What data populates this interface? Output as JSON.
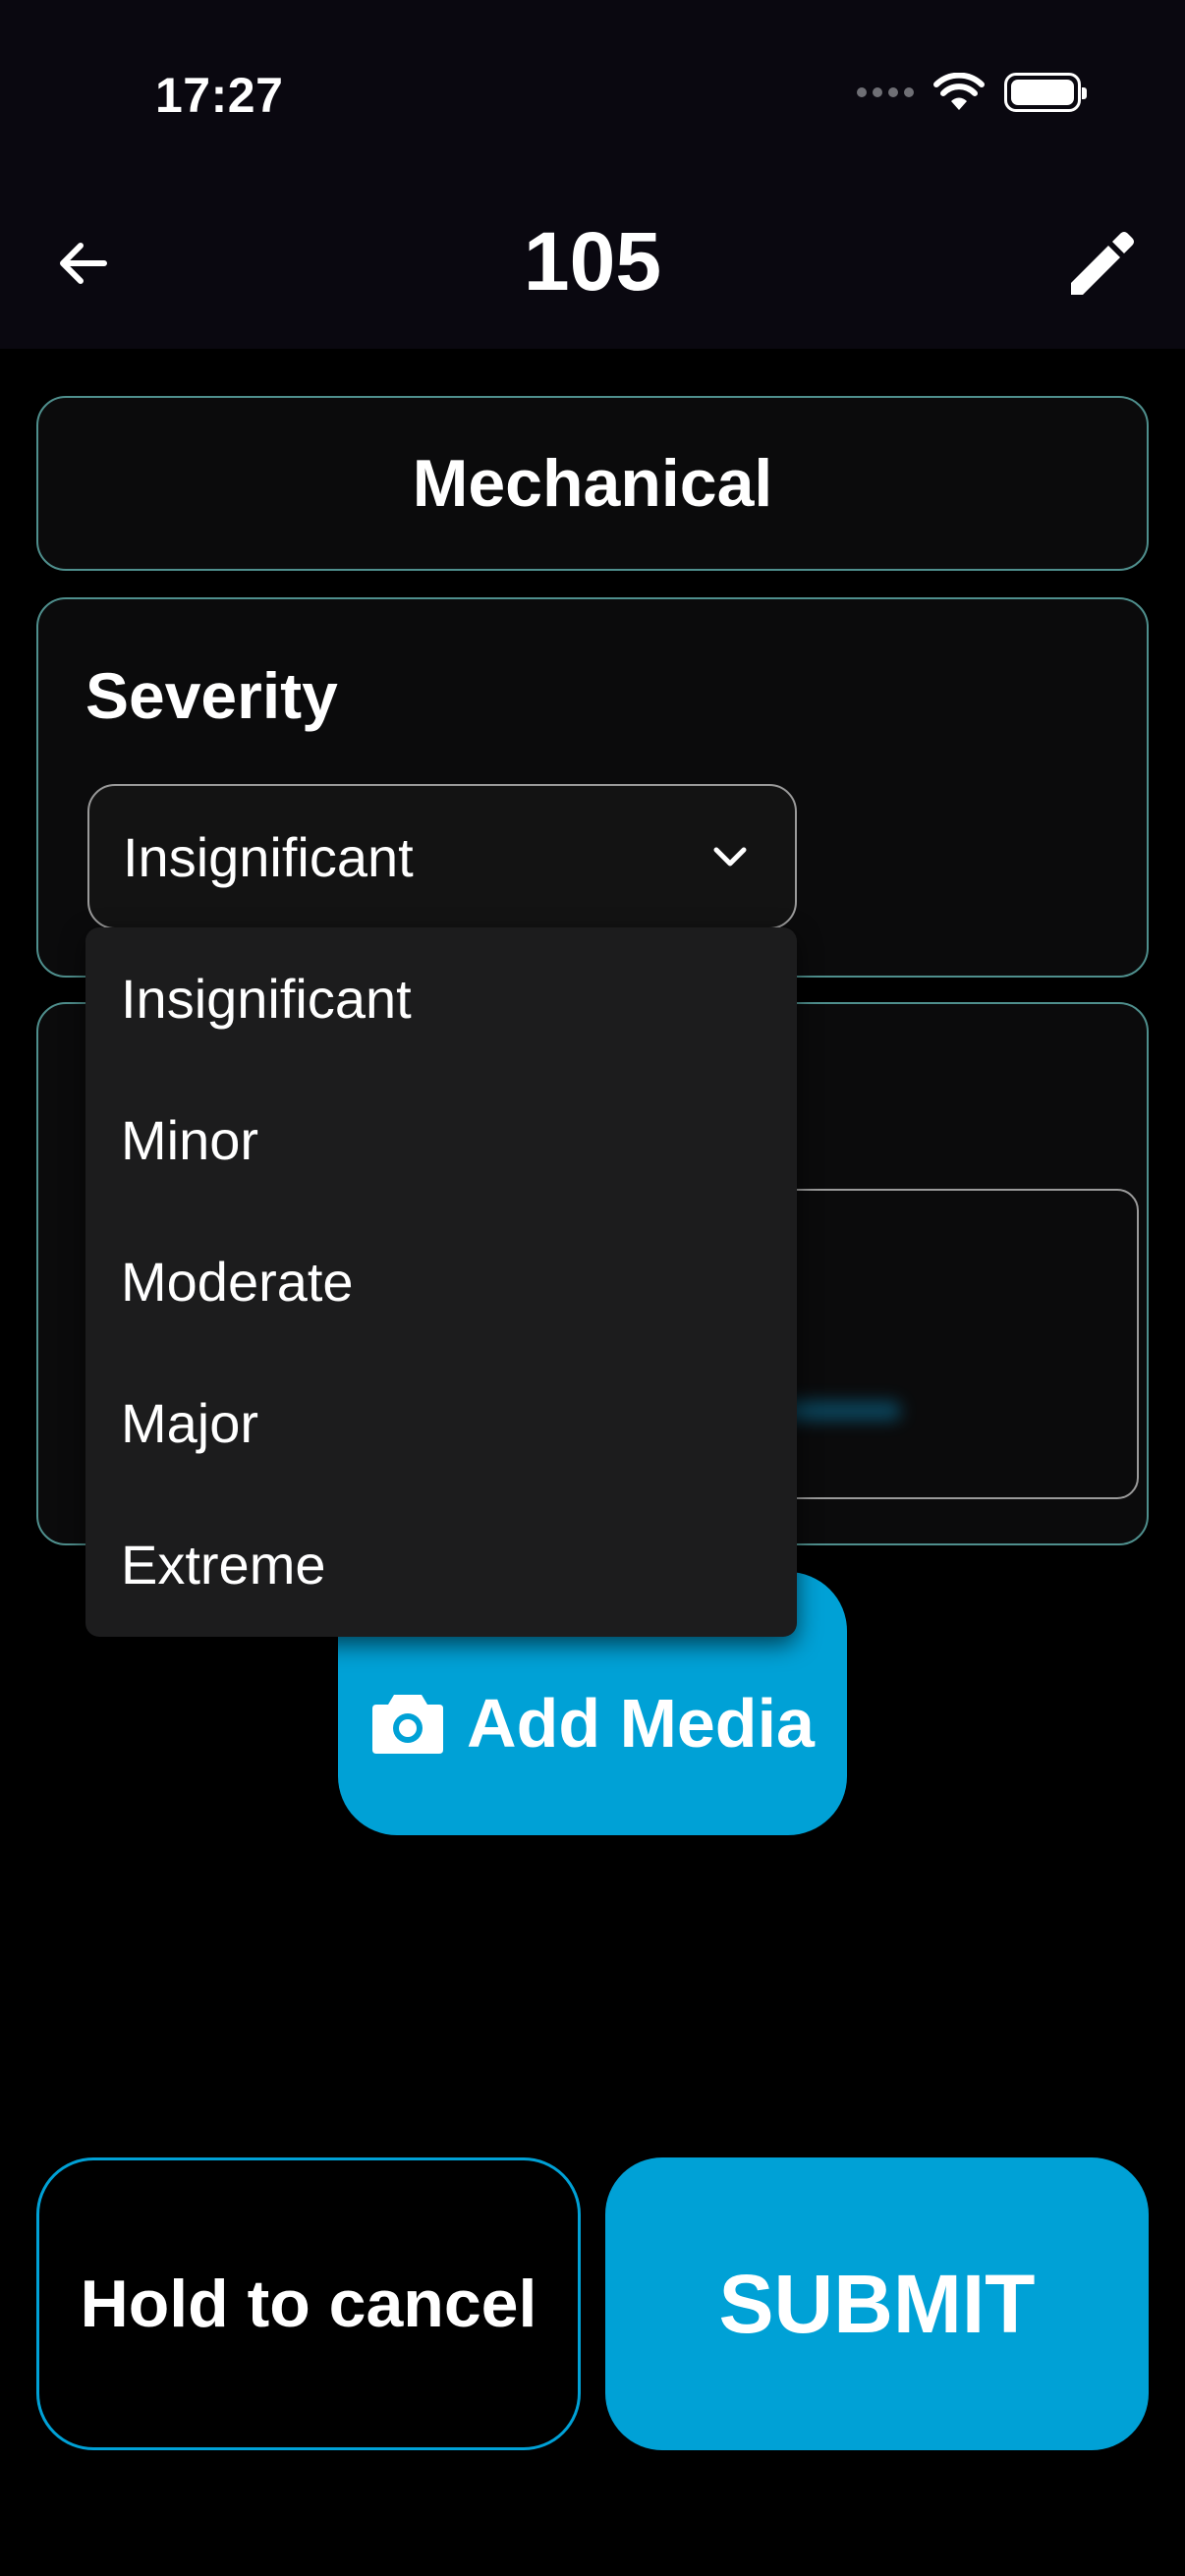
{
  "status_bar": {
    "time": "17:27"
  },
  "header": {
    "title": "105",
    "back_icon": "arrow-left-icon",
    "edit_icon": "pencil-icon"
  },
  "category": {
    "value": "Mechanical"
  },
  "severity": {
    "label": "Severity",
    "selected": "Insignificant",
    "options": [
      "Insignificant",
      "Minor",
      "Moderate",
      "Major",
      "Extreme"
    ]
  },
  "media": {
    "button_label": "Add Media",
    "icon": "camera-icon"
  },
  "actions": {
    "cancel_label": "Hold to cancel",
    "submit_label": "SUBMIT"
  },
  "colors": {
    "accent": "#00a1d6",
    "card_border": "#4f8f8d",
    "background": "#000000"
  }
}
